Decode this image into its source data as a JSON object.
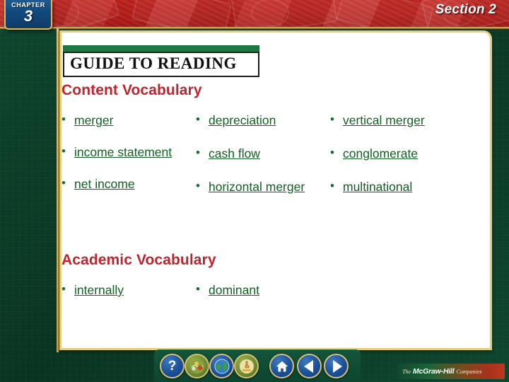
{
  "slide": {
    "chapter": {
      "word": "CHAPTER",
      "number": "3"
    },
    "section_label": "Section 2",
    "guide": {
      "title": "GUIDE TO READING"
    },
    "content_vocabulary": {
      "heading": "Content Vocabulary",
      "columns": [
        {
          "items": [
            "merger",
            "income statement",
            "net income"
          ]
        },
        {
          "items": [
            "depreciation",
            "cash flow",
            "horizontal merger"
          ]
        },
        {
          "items": [
            "vertical merger",
            "conglomerate",
            "multinational"
          ]
        }
      ]
    },
    "academic_vocabulary": {
      "heading": "Academic Vocabulary",
      "columns": [
        {
          "items": [
            "internally"
          ]
        },
        {
          "items": [
            "dominant"
          ]
        }
      ]
    },
    "bullet_char": "•",
    "toolbar": {
      "buttons": [
        {
          "name": "help-button",
          "icon": "question-mark-icon",
          "glyph": "?",
          "style": "blue"
        },
        {
          "name": "media-button",
          "icon": "multimedia-icon",
          "glyph": "✿",
          "style": "gold"
        },
        {
          "name": "globe-button",
          "icon": "globe-icon",
          "glyph": "ἱ0",
          "style": "blue"
        },
        {
          "name": "activity-button",
          "icon": "hand-click-icon",
          "glyph": "☚",
          "style": "gold"
        },
        {
          "name": "home-button",
          "icon": "home-icon",
          "glyph": "⌂",
          "style": "blue"
        },
        {
          "name": "previous-button",
          "icon": "left-arrow-icon",
          "glyph": "",
          "style": "blue"
        },
        {
          "name": "next-button",
          "icon": "right-arrow-icon",
          "glyph": "",
          "style": "blue"
        }
      ]
    },
    "publisher_logo": {
      "the": "The",
      "name": "McGraw-Hill",
      "companies": "Companies"
    },
    "colors": {
      "banner_red": "#b91d19",
      "heading_red": "#c0242e",
      "vocab_green": "#136023",
      "slide_green": "#0e4830",
      "gold": "#e8cd79",
      "badge_blue": "#12497c"
    }
  }
}
